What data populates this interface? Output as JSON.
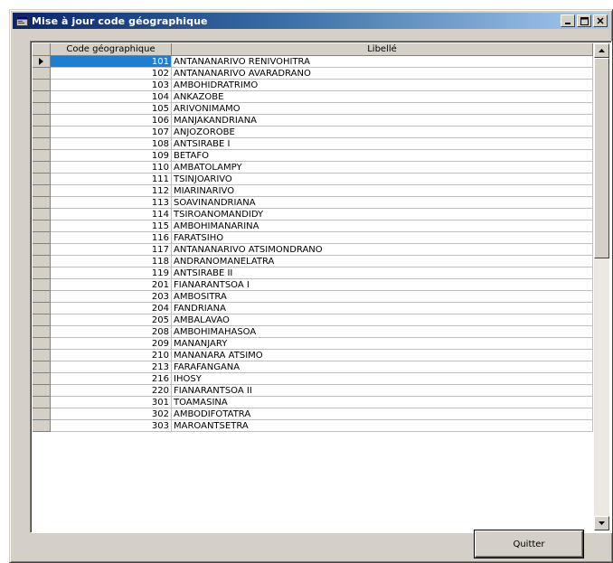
{
  "window": {
    "title": "Mise à jour code géographique",
    "icon": "app-icon",
    "controls": [
      "minimize-icon",
      "maximize-icon",
      "close-icon"
    ]
  },
  "grid": {
    "columns": [
      "Code géographique",
      "Libellé"
    ],
    "selected_row": 0,
    "rows": [
      {
        "code": "101",
        "libelle": "ANTANANARIVO RENIVOHITRA"
      },
      {
        "code": "102",
        "libelle": "ANTANANARIVO AVARADRANO"
      },
      {
        "code": "103",
        "libelle": "AMBOHIDRATRIMO"
      },
      {
        "code": "104",
        "libelle": "ANKAZOBE"
      },
      {
        "code": "105",
        "libelle": "ARIVONIMAMO"
      },
      {
        "code": "106",
        "libelle": "MANJAKANDRIANA"
      },
      {
        "code": "107",
        "libelle": "ANJOZOROBE"
      },
      {
        "code": "108",
        "libelle": "ANTSIRABE I"
      },
      {
        "code": "109",
        "libelle": "BETAFO"
      },
      {
        "code": "110",
        "libelle": "AMBATOLAMPY"
      },
      {
        "code": "111",
        "libelle": "TSINJOARIVO"
      },
      {
        "code": "112",
        "libelle": "MIARINARIVO"
      },
      {
        "code": "113",
        "libelle": "SOAVINANDRIANA"
      },
      {
        "code": "114",
        "libelle": "TSIROANOMANDIDY"
      },
      {
        "code": "115",
        "libelle": "AMBOHIMANARINA"
      },
      {
        "code": "116",
        "libelle": "FARATSIHO"
      },
      {
        "code": "117",
        "libelle": "ANTANANARIVO ATSIMONDRANO"
      },
      {
        "code": "118",
        "libelle": "ANDRANOMANELATRA"
      },
      {
        "code": "119",
        "libelle": "ANTSIRABE II"
      },
      {
        "code": "201",
        "libelle": "FIANARANTSOA I"
      },
      {
        "code": "203",
        "libelle": "AMBOSITRA"
      },
      {
        "code": "204",
        "libelle": "FANDRIANA"
      },
      {
        "code": "205",
        "libelle": "AMBALAVAO"
      },
      {
        "code": "208",
        "libelle": "AMBOHIMAHASOA"
      },
      {
        "code": "209",
        "libelle": "MANANJARY"
      },
      {
        "code": "210",
        "libelle": "MANANARA ATSIMO"
      },
      {
        "code": "213",
        "libelle": "FARAFANGANA"
      },
      {
        "code": "216",
        "libelle": "IHOSY"
      },
      {
        "code": "220",
        "libelle": "FIANARANTSOA II"
      },
      {
        "code": "301",
        "libelle": "TOAMASINA"
      },
      {
        "code": "302",
        "libelle": "AMBODIFOTATRA"
      },
      {
        "code": "303",
        "libelle": "MAROANTSETRA"
      }
    ]
  },
  "footer": {
    "quit_label": "Quitter"
  }
}
